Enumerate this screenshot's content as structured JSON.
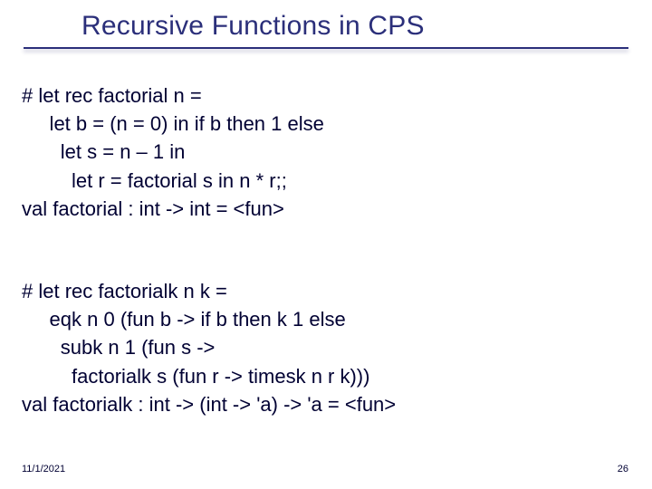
{
  "title": "Recursive Functions in CPS",
  "code_block_1": "# let rec factorial n =\n     let b = (n = 0) in if b then 1 else\n       let s = n – 1 in\n         let r = factorial s in n * r;;\nval factorial : int -> int = <fun>",
  "code_block_2": "# let rec factorialk n k =\n     eqk n 0 (fun b -> if b then k 1 else\n       subk n 1 (fun s ->\n         factorialk s (fun r -> timesk n r k)))\nval factorialk : int -> (int -> 'a) -> 'a = <fun>",
  "footer": {
    "date": "11/1/2021",
    "page": "26"
  }
}
